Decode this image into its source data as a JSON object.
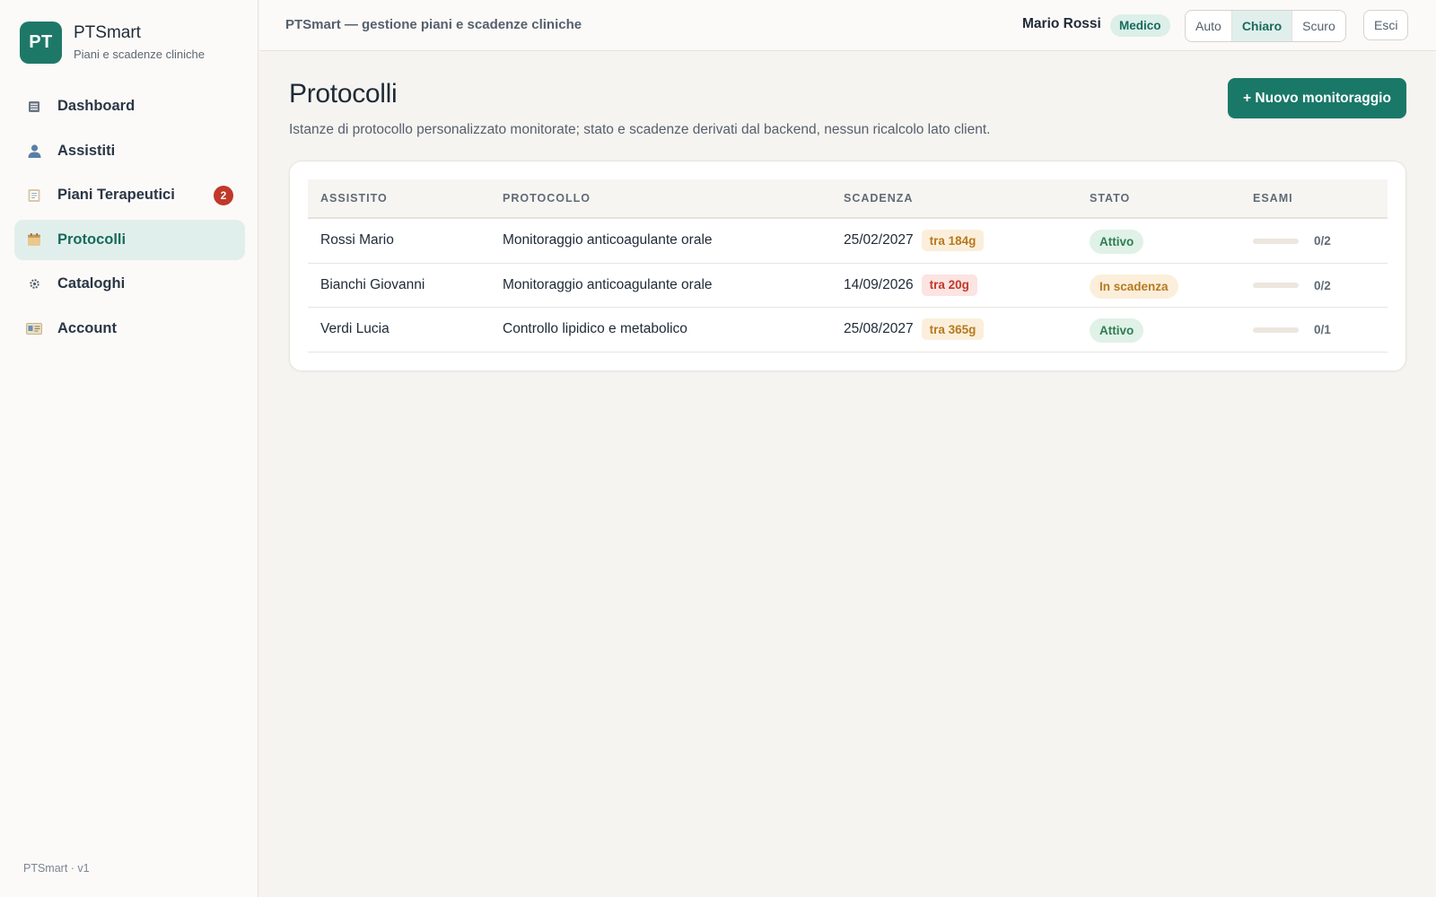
{
  "brand": {
    "logo_text": "PT",
    "name": "PTSmart",
    "subtitle": "Piani e scadenze cliniche"
  },
  "nav": [
    {
      "label": "Dashboard",
      "icon": "dashboard-icon",
      "active": false
    },
    {
      "label": "Assistiti",
      "icon": "person-icon",
      "active": false
    },
    {
      "label": "Piani Terapeutici",
      "icon": "clipboard-icon",
      "active": false,
      "badge": "2"
    },
    {
      "label": "Protocolli",
      "icon": "calendar-icon",
      "active": true
    },
    {
      "label": "Cataloghi",
      "icon": "gear-icon",
      "active": false
    },
    {
      "label": "Account",
      "icon": "id-card-icon",
      "active": false
    }
  ],
  "footer": "PTSmart · v1",
  "topbar": {
    "title": "PTSmart — gestione piani e scadenze cliniche",
    "user": "Mario Rossi",
    "role": "Medico",
    "theme_options": [
      "Auto",
      "Chiaro",
      "Scuro"
    ],
    "theme_selected": "Chiaro",
    "logout": "Esci"
  },
  "page": {
    "title": "Protocolli",
    "description": "Istanze di protocollo personalizzato monitorate; stato e scadenze derivati dal backend, nessun ricalcolo lato client.",
    "new_button": "+ Nuovo monitoraggio"
  },
  "table": {
    "headers": [
      "ASSISTITO",
      "PROTOCOLLO",
      "SCADENZA",
      "STATO",
      "ESAMI"
    ],
    "rows": [
      {
        "patient": "Rossi Mario",
        "protocol": "Monitoraggio anticoagulante orale",
        "due": "25/02/2027",
        "due_chip": "tra 184g",
        "due_tone": "warn",
        "status": "Attivo",
        "status_tone": "ok",
        "exams": "0/2",
        "exams_progress": 0
      },
      {
        "patient": "Bianchi Giovanni",
        "protocol": "Monitoraggio anticoagulante orale",
        "due": "14/09/2026",
        "due_chip": "tra 20g",
        "due_tone": "danger",
        "status": "In scadenza",
        "status_tone": "warn",
        "exams": "0/2",
        "exams_progress": 0
      },
      {
        "patient": "Verdi Lucia",
        "protocol": "Controllo lipidico e metabolico",
        "due": "25/08/2027",
        "due_chip": "tra 365g",
        "due_tone": "warn",
        "status": "Attivo",
        "status_tone": "ok",
        "exams": "0/1",
        "exams_progress": 0
      }
    ]
  },
  "colors": {
    "accent": "#1a7868",
    "warn_bg": "#fbefdb",
    "warn_fg": "#b7791f",
    "danger_bg": "#fbe4e1",
    "danger_fg": "#c0392b",
    "ok_bg": "#e0f1e8",
    "ok_fg": "#2e7d4f",
    "pill_warn_bg": "#fbefdb",
    "pill_warn_fg": "#b7791f"
  }
}
